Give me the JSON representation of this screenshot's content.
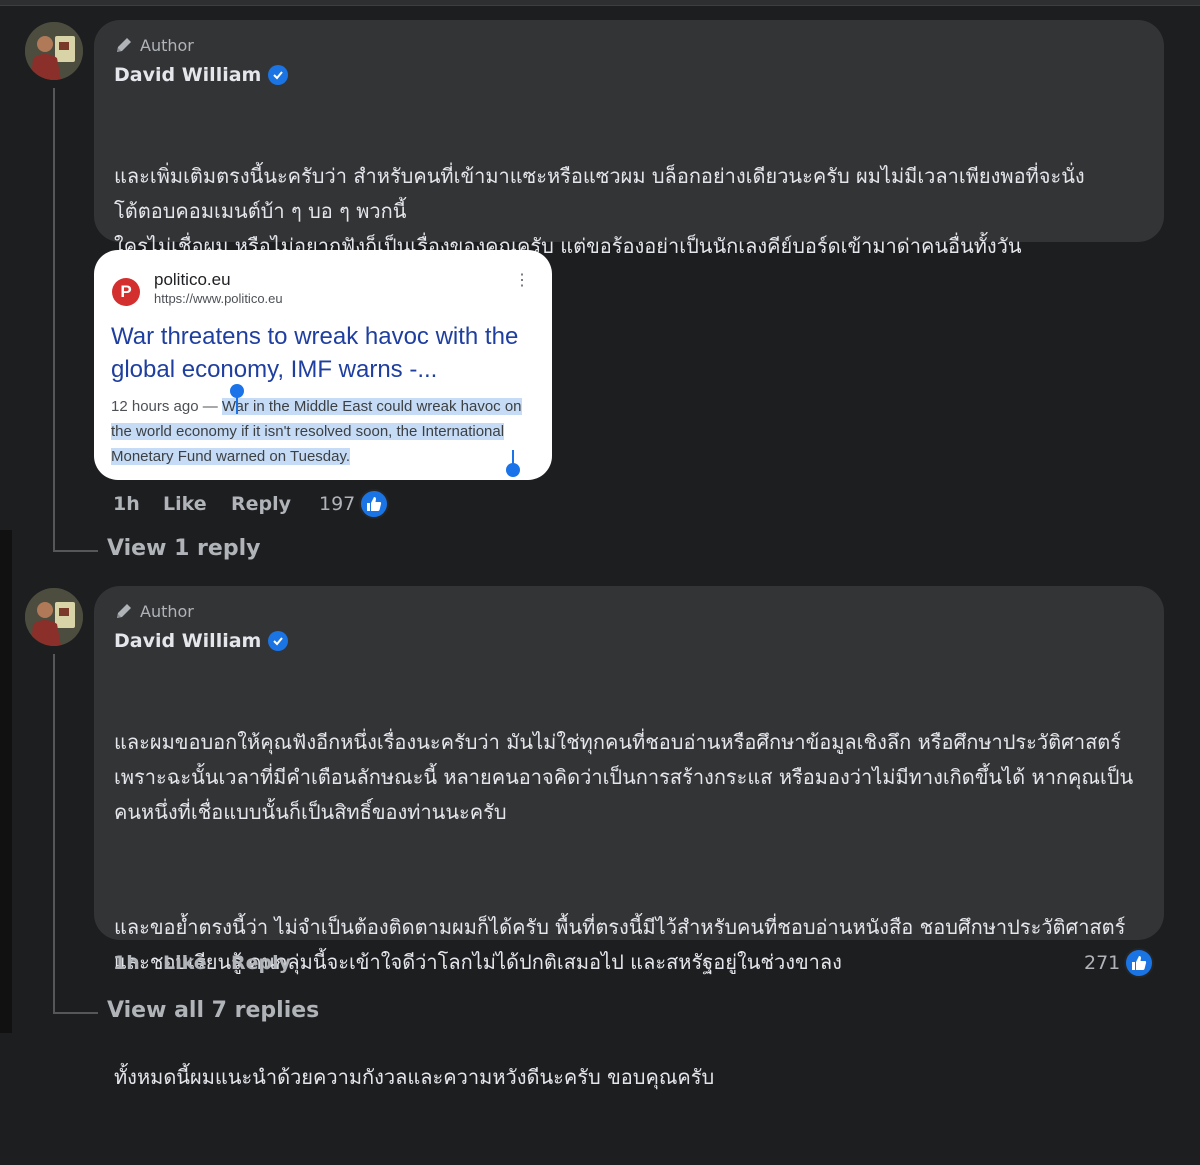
{
  "comments": [
    {
      "badge": "Author",
      "name": "David William",
      "paragraphs": [
        "และเพิ่มเติมตรงนี้นะครับว่า สำหรับคนที่เข้ามาแซะหรือแซวผม บล็อกอย่างเดียวนะครับ ผมไม่มีเวลาเพียงพอที่จะนั่งโต้ตอบคอมเมนต์บ้า ๆ บอ ๆ พวกนี้\nใครไม่เชื่อผม หรือไม่อยากฟังก็เป็นเรื่องของคุณครับ แต่ขอร้องอย่าเป็นนักเลงคีย์บอร์ดเข้ามาด่าคนอื่นทั้งวัน"
      ],
      "time": "1h",
      "like_label": "Like",
      "reply_label": "Reply",
      "reactions": "197",
      "view_replies": "View 1 reply"
    },
    {
      "badge": "Author",
      "name": "David William",
      "paragraphs": [
        "และผมขอบอกให้คุณฟังอีกหนึ่งเรื่องนะครับว่า มันไม่ใช่ทุกคนที่ชอบอ่านหรือศึกษาข้อมูลเชิงลึก หรือศึกษาประวัติศาสตร์ เพราะฉะนั้นเวลาที่มีคำเตือนลักษณะนี้ หลายคนอาจคิดว่าเป็นการสร้างกระแส หรือมองว่าไม่มีทางเกิดขึ้นได้ หากคุณเป็นคนหนึ่งที่เชื่อแบบนั้นก็เป็นสิทธิ์ของท่านนะครับ",
        "และขอย้ำตรงนี้ว่า ไม่จำเป็นต้องติดตามผมก็ได้ครับ พื้นที่ตรงนี้มีไว้สำหรับคนที่ชอบอ่านหนังสือ ชอบศึกษาประวัติศาสตร์ และชอบเรียนรู้ คนกลุ่มนี้จะเข้าใจดีว่าโลกไม่ได้ปกติเสมอไป และสหรัฐอยู่ในช่วงขาลง",
        "ทั้งหมดนี้ผมแนะนำด้วยความกังวลและความหวังดีนะครับ ขอบคุณครับ"
      ],
      "time": "1h",
      "like_label": "Like",
      "reply_label": "Reply",
      "reactions": "271",
      "view_replies": "View all 7 replies"
    }
  ],
  "link_card": {
    "favicon_letter": "P",
    "site": "politico.eu",
    "url": "https://www.politico.eu",
    "headline": "War threatens to wreak havoc with the global economy, IMF warns -...",
    "age": "12 hours ago",
    "dash": "—",
    "snippet": "War in the Middle East could wreak havoc on the world economy if it isn't resolved soon, the International Monetary Fund warned on Tuesday."
  },
  "colors": {
    "background": "#1d1e20",
    "bubble": "#333436",
    "verified": "#1b74e4",
    "link_headline": "#1f3fa0",
    "selection": "#c6dcf6"
  },
  "icons": [
    "pencil-icon",
    "verified-badge-icon",
    "more-options-icon",
    "like-reaction-icon"
  ]
}
